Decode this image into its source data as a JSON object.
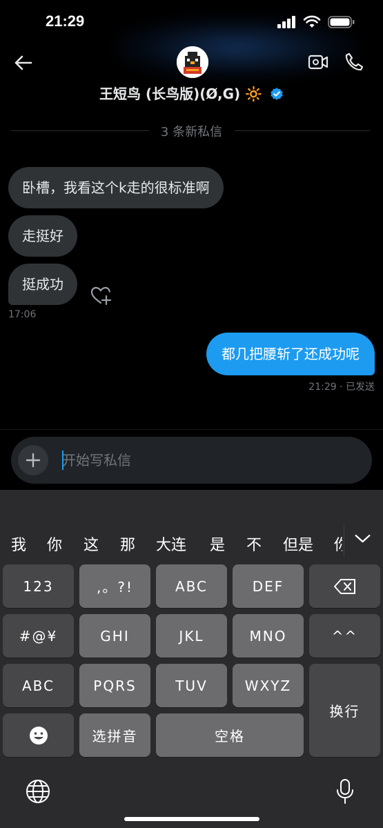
{
  "status_bar": {
    "time": "21:29"
  },
  "header": {
    "contact_name": "王短鸟 (长鸟版)(Ø,G) 🔆",
    "accent": "#1d9bf0"
  },
  "divider": {
    "new_messages": "3 条新私信"
  },
  "messages": {
    "incoming": [
      "卧槽，我看这个k走的很标准啊",
      "走挺好",
      "挺成功"
    ],
    "incoming_time": "17:06",
    "outgoing": "都几把腰斩了还成功呢",
    "outgoing_status": "21:29 · 已发送"
  },
  "composer": {
    "placeholder": "开始写私信"
  },
  "keyboard": {
    "candidates": [
      "我",
      "你",
      "这",
      "那",
      "大连",
      "是",
      "不",
      "但是",
      "你"
    ],
    "row1": [
      "123",
      ",。?!",
      "ABC",
      "DEF"
    ],
    "row2": [
      "#@¥",
      "GHI",
      "JKL",
      "MNO",
      "^^"
    ],
    "row3": [
      "ABC",
      "PQRS",
      "TUV",
      "WXYZ"
    ],
    "row4": [
      "选拼音",
      "空格"
    ],
    "enter": "换行"
  },
  "icons": [
    "back-arrow-icon",
    "verified-badge-icon",
    "video-call-icon",
    "phone-icon",
    "heart-plus-icon",
    "plus-icon",
    "voice-wave-icon",
    "chevron-down-icon",
    "backspace-icon",
    "emoji-icon",
    "globe-icon",
    "microphone-icon"
  ]
}
